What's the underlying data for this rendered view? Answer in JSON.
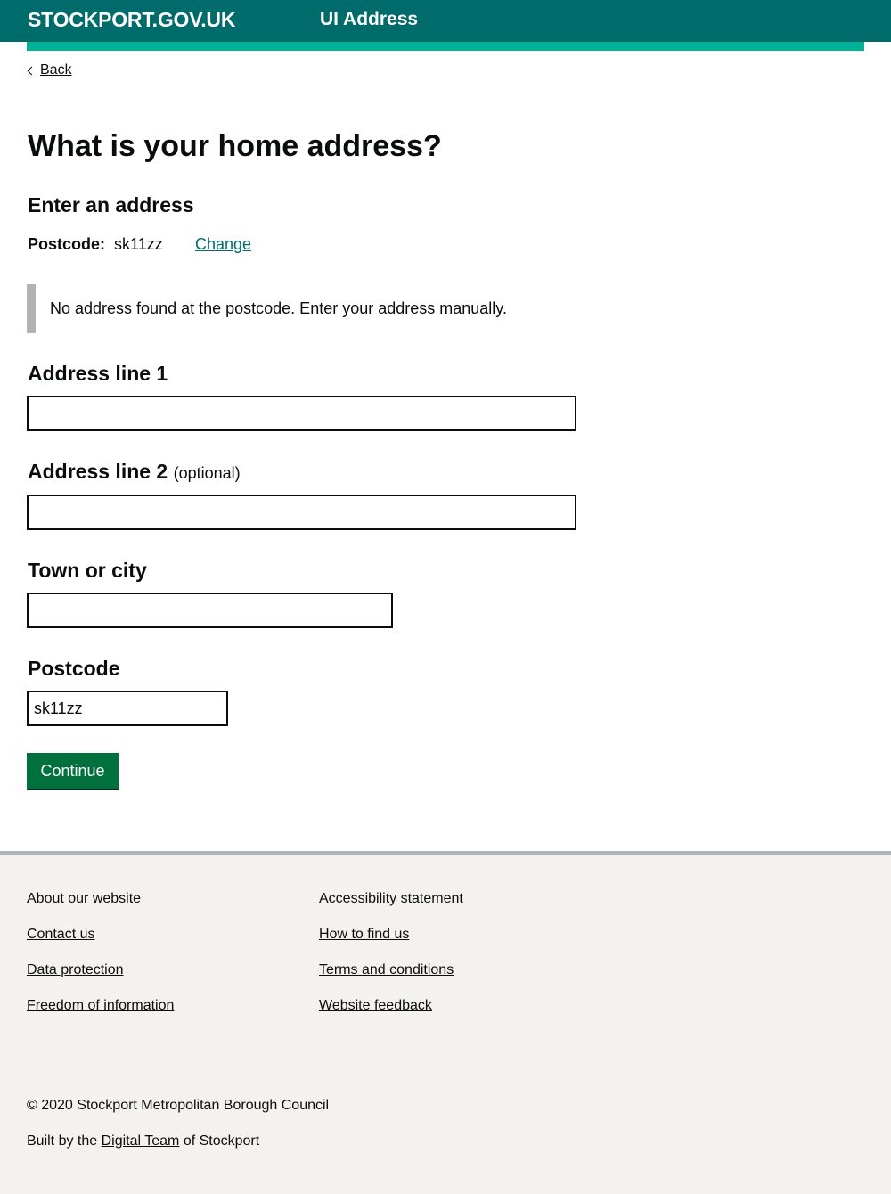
{
  "header": {
    "site_name": "STOCKPORT.GOV.UK",
    "service_name": "UI Address",
    "bar_color": "#006b6b",
    "accent_color": "#00b398"
  },
  "back": {
    "label": "Back",
    "icon": "chevron-left-icon"
  },
  "page": {
    "title": "What is your home address?",
    "subheading": "Enter an address",
    "postcode_summary": {
      "label": "Postcode:",
      "value": "sk11zz",
      "change_label": "Change"
    },
    "inset_text": "No address found at the postcode. Enter your address manually."
  },
  "form": {
    "address_line_1": {
      "label": "Address line 1",
      "value": ""
    },
    "address_line_2": {
      "label": "Address line 2",
      "hint": "(optional)",
      "value": ""
    },
    "town": {
      "label": "Town or city",
      "value": ""
    },
    "postcode": {
      "label": "Postcode",
      "value": "sk11zz"
    },
    "submit_label": "Continue",
    "button_color": "#00703c"
  },
  "footer": {
    "links_col1": [
      "About our website",
      "Contact us",
      "Data protection",
      "Freedom of information"
    ],
    "links_col2": [
      "Accessibility statement",
      "How to find us",
      "Terms and conditions",
      "Website feedback"
    ],
    "copyright": "© 2020 Stockport Metropolitan Borough Council",
    "built_prefix": "Built by the",
    "built_link": "Digital Team",
    "built_suffix": "of Stockport"
  }
}
